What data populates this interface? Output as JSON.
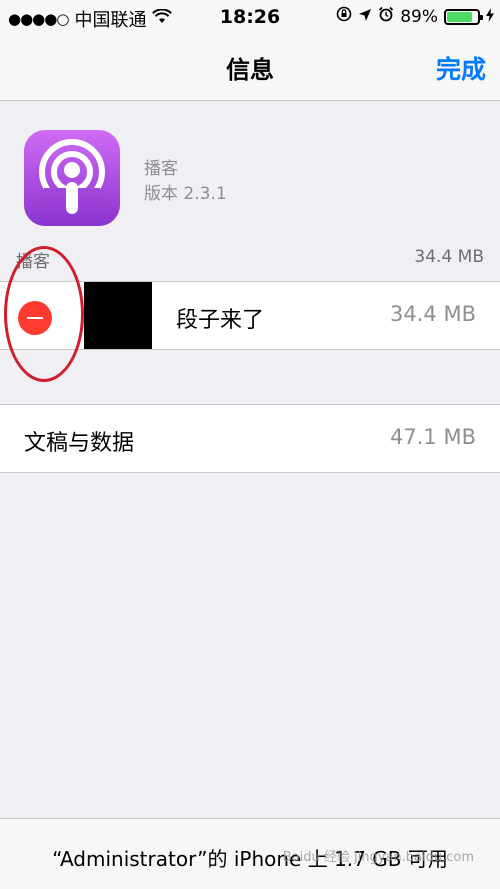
{
  "status_bar": {
    "signal_dots": "●●●●○",
    "carrier": "中国联通",
    "time": "18:26",
    "battery_percent": "89%",
    "battery_level": 0.89,
    "battery_color": "#4cd964"
  },
  "nav": {
    "title": "信息",
    "done_label": "完成",
    "accent_color": "#007aff"
  },
  "app": {
    "name": "播客",
    "version": "版本 2.3.1",
    "icon": "podcasts-icon"
  },
  "section": {
    "label": "播客",
    "size": "34.4 MB"
  },
  "episode": {
    "title": "段子来了",
    "size": "34.4 MB",
    "delete_icon": "minus-circle-icon"
  },
  "documents": {
    "label": "文稿与数据",
    "size": "47.1 MB"
  },
  "footer": {
    "storage_text": "“Administrator”的 iPhone 上 1.7 GB 可用"
  },
  "watermark": "Baidu 经验 jingyan.baidu.com"
}
